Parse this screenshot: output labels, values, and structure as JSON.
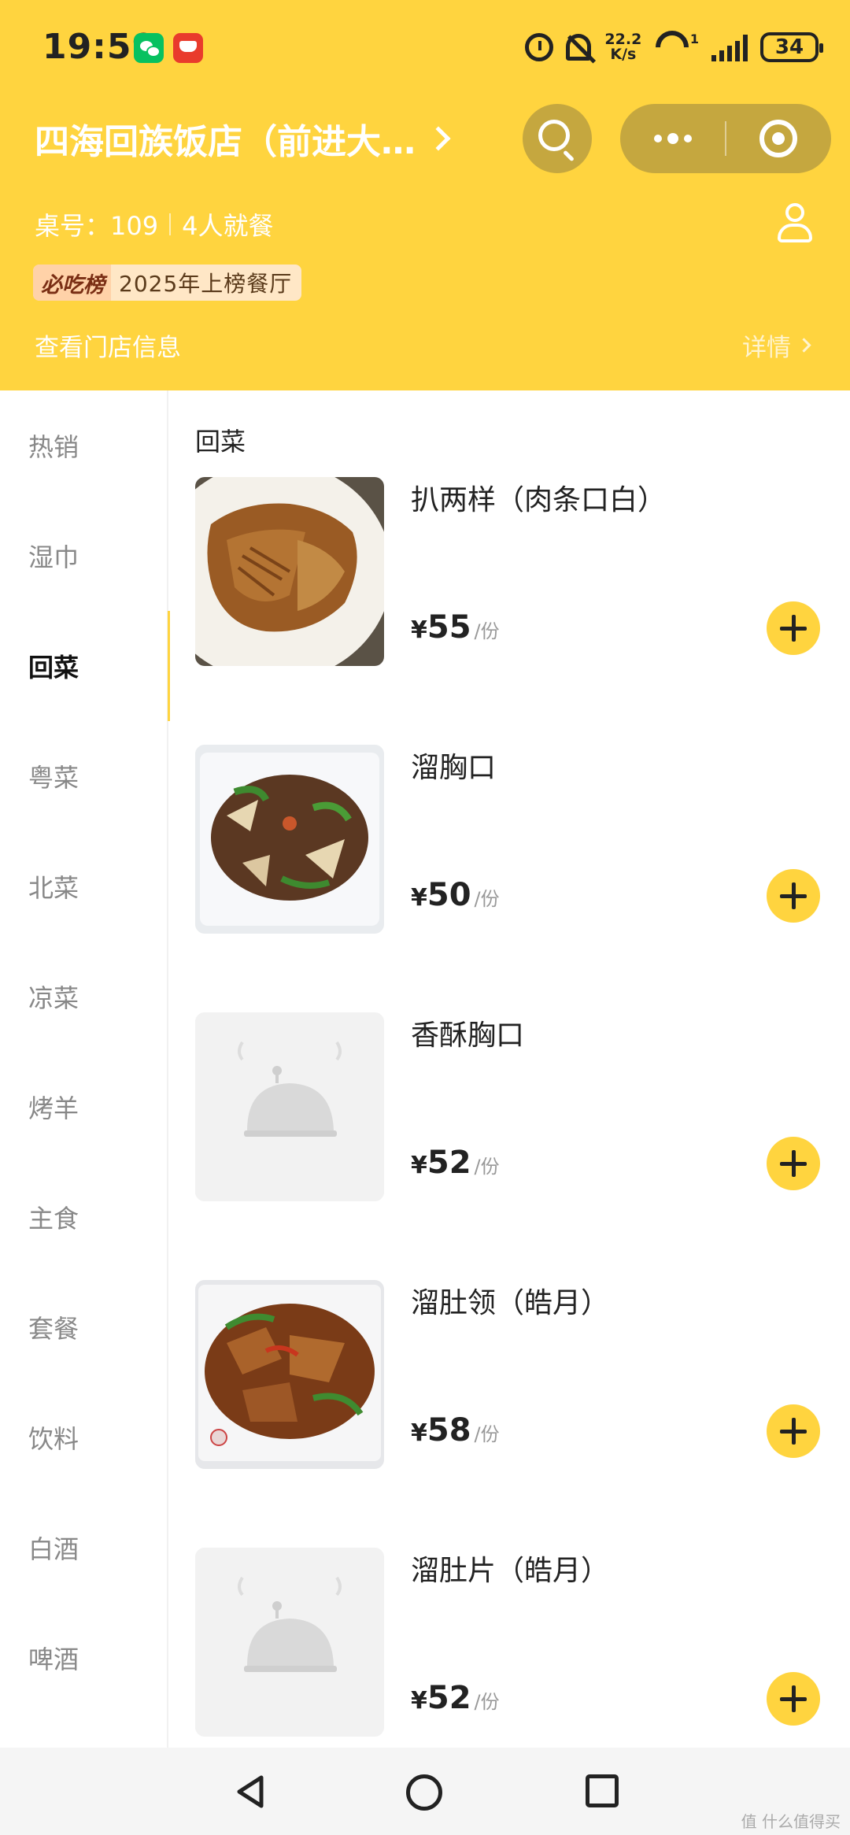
{
  "status_bar": {
    "time": "19:59",
    "net_speed_value": "22.2",
    "net_speed_unit": "K/s",
    "wifi_label": "1",
    "battery": "34"
  },
  "header": {
    "store_name": "四海回族饭店（前进大…",
    "table_label": "桌号：109",
    "diners": "4人就餐",
    "rank_logo": "必吃榜",
    "rank_text": "2025年上榜餐厅",
    "store_info": "查看门店信息",
    "details": "详情"
  },
  "sidebar": {
    "active_index": 2,
    "items": [
      {
        "label": "热销"
      },
      {
        "label": "湿巾"
      },
      {
        "label": "回菜"
      },
      {
        "label": "粤菜"
      },
      {
        "label": "北菜"
      },
      {
        "label": "凉菜"
      },
      {
        "label": "烤羊"
      },
      {
        "label": "主食"
      },
      {
        "label": "套餐"
      },
      {
        "label": "饮料"
      },
      {
        "label": "白酒"
      },
      {
        "label": "啤酒"
      }
    ]
  },
  "menu": {
    "section_title": "回菜",
    "dishes": [
      {
        "name": "扒两样（肉条口白）",
        "currency": "¥",
        "price": "55",
        "unit": "/份",
        "image": "food-photo-braised"
      },
      {
        "name": "溜胸口",
        "currency": "¥",
        "price": "50",
        "unit": "/份",
        "image": "food-photo-stirfry"
      },
      {
        "name": "香酥胸口",
        "currency": "¥",
        "price": "52",
        "unit": "/份",
        "image": "placeholder-cloche-icon"
      },
      {
        "name": "溜肚领（皓月）",
        "currency": "¥",
        "price": "58",
        "unit": "/份",
        "image": "food-photo-tripe"
      },
      {
        "name": "溜肚片（皓月）",
        "currency": "¥",
        "price": "52",
        "unit": "/份",
        "image": "placeholder-cloche-icon"
      }
    ]
  },
  "watermark": "值 什么值得买",
  "colors": {
    "brand_yellow": "#FFD43F",
    "capsule": "#C5A73F"
  }
}
